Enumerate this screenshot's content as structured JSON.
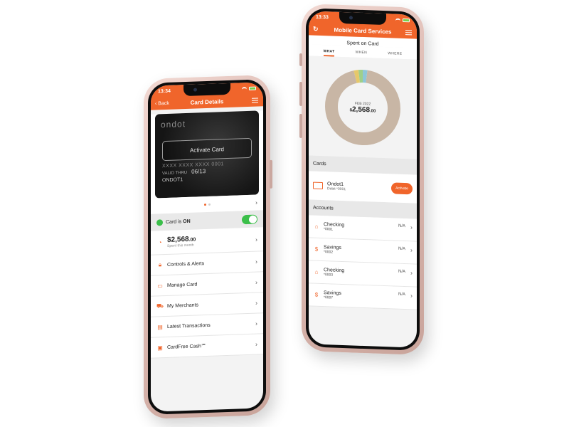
{
  "left": {
    "status": {
      "time": "13:34"
    },
    "nav": {
      "back": "Back",
      "title": "Card Details"
    },
    "card": {
      "brand": "ondot",
      "activate": "Activate Card",
      "number": "XXXX XXXX XXXX 0001",
      "valid_thru_label": "VALID THRU",
      "expiry": "06/13",
      "holder": "ONDOT1"
    },
    "toggle": {
      "label_prefix": "Card is ",
      "label_state": "ON"
    },
    "spent": {
      "amount": "$2,568",
      "cents": ".00",
      "subtitle": "Spent this month"
    },
    "menu": [
      {
        "label": "Controls & Alerts",
        "icon": "lock-icon"
      },
      {
        "label": "Manage Card",
        "icon": "card-icon"
      },
      {
        "label": "My Merchants",
        "icon": "cart-icon"
      },
      {
        "label": "Latest Transactions",
        "icon": "receipt-icon"
      },
      {
        "label": "CardFree Cash℠",
        "icon": "cash-icon"
      }
    ]
  },
  "right": {
    "status": {
      "time": "13:33"
    },
    "nav": {
      "title": "Mobile Card Services"
    },
    "section_title": "Spent on Card",
    "tabs": [
      "WHAT",
      "WHEN",
      "WHERE"
    ],
    "active_tab": "WHAT",
    "donut": {
      "month": "FEB 2022",
      "currency": "$",
      "amount": "2,568",
      "cents": ".00",
      "segments": [
        {
          "value": 94,
          "color": "#c8b6a5"
        },
        {
          "value": 2,
          "color": "#e6c86a"
        },
        {
          "value": 2,
          "color": "#9fcf8a"
        },
        {
          "value": 2,
          "color": "#8ec6d8"
        }
      ]
    },
    "cards_header": "Cards",
    "card_item": {
      "name": "Ondot1",
      "detail": "Debit *0001",
      "button": "Activate"
    },
    "accounts_header": "Accounts",
    "accounts": [
      {
        "name": "Checking",
        "number": "*0001",
        "status": "N/A",
        "icon": "house-icon"
      },
      {
        "name": "Savings",
        "number": "*0002",
        "status": "N/A",
        "icon": "moneybag-icon"
      },
      {
        "name": "Checking",
        "number": "*0003",
        "status": "N/A",
        "icon": "house-icon"
      },
      {
        "name": "Savings",
        "number": "*0007",
        "status": "N/A",
        "icon": "moneybag-icon"
      }
    ]
  },
  "colors": {
    "accent": "#f0652b",
    "toggle_on": "#3bbf4a"
  }
}
